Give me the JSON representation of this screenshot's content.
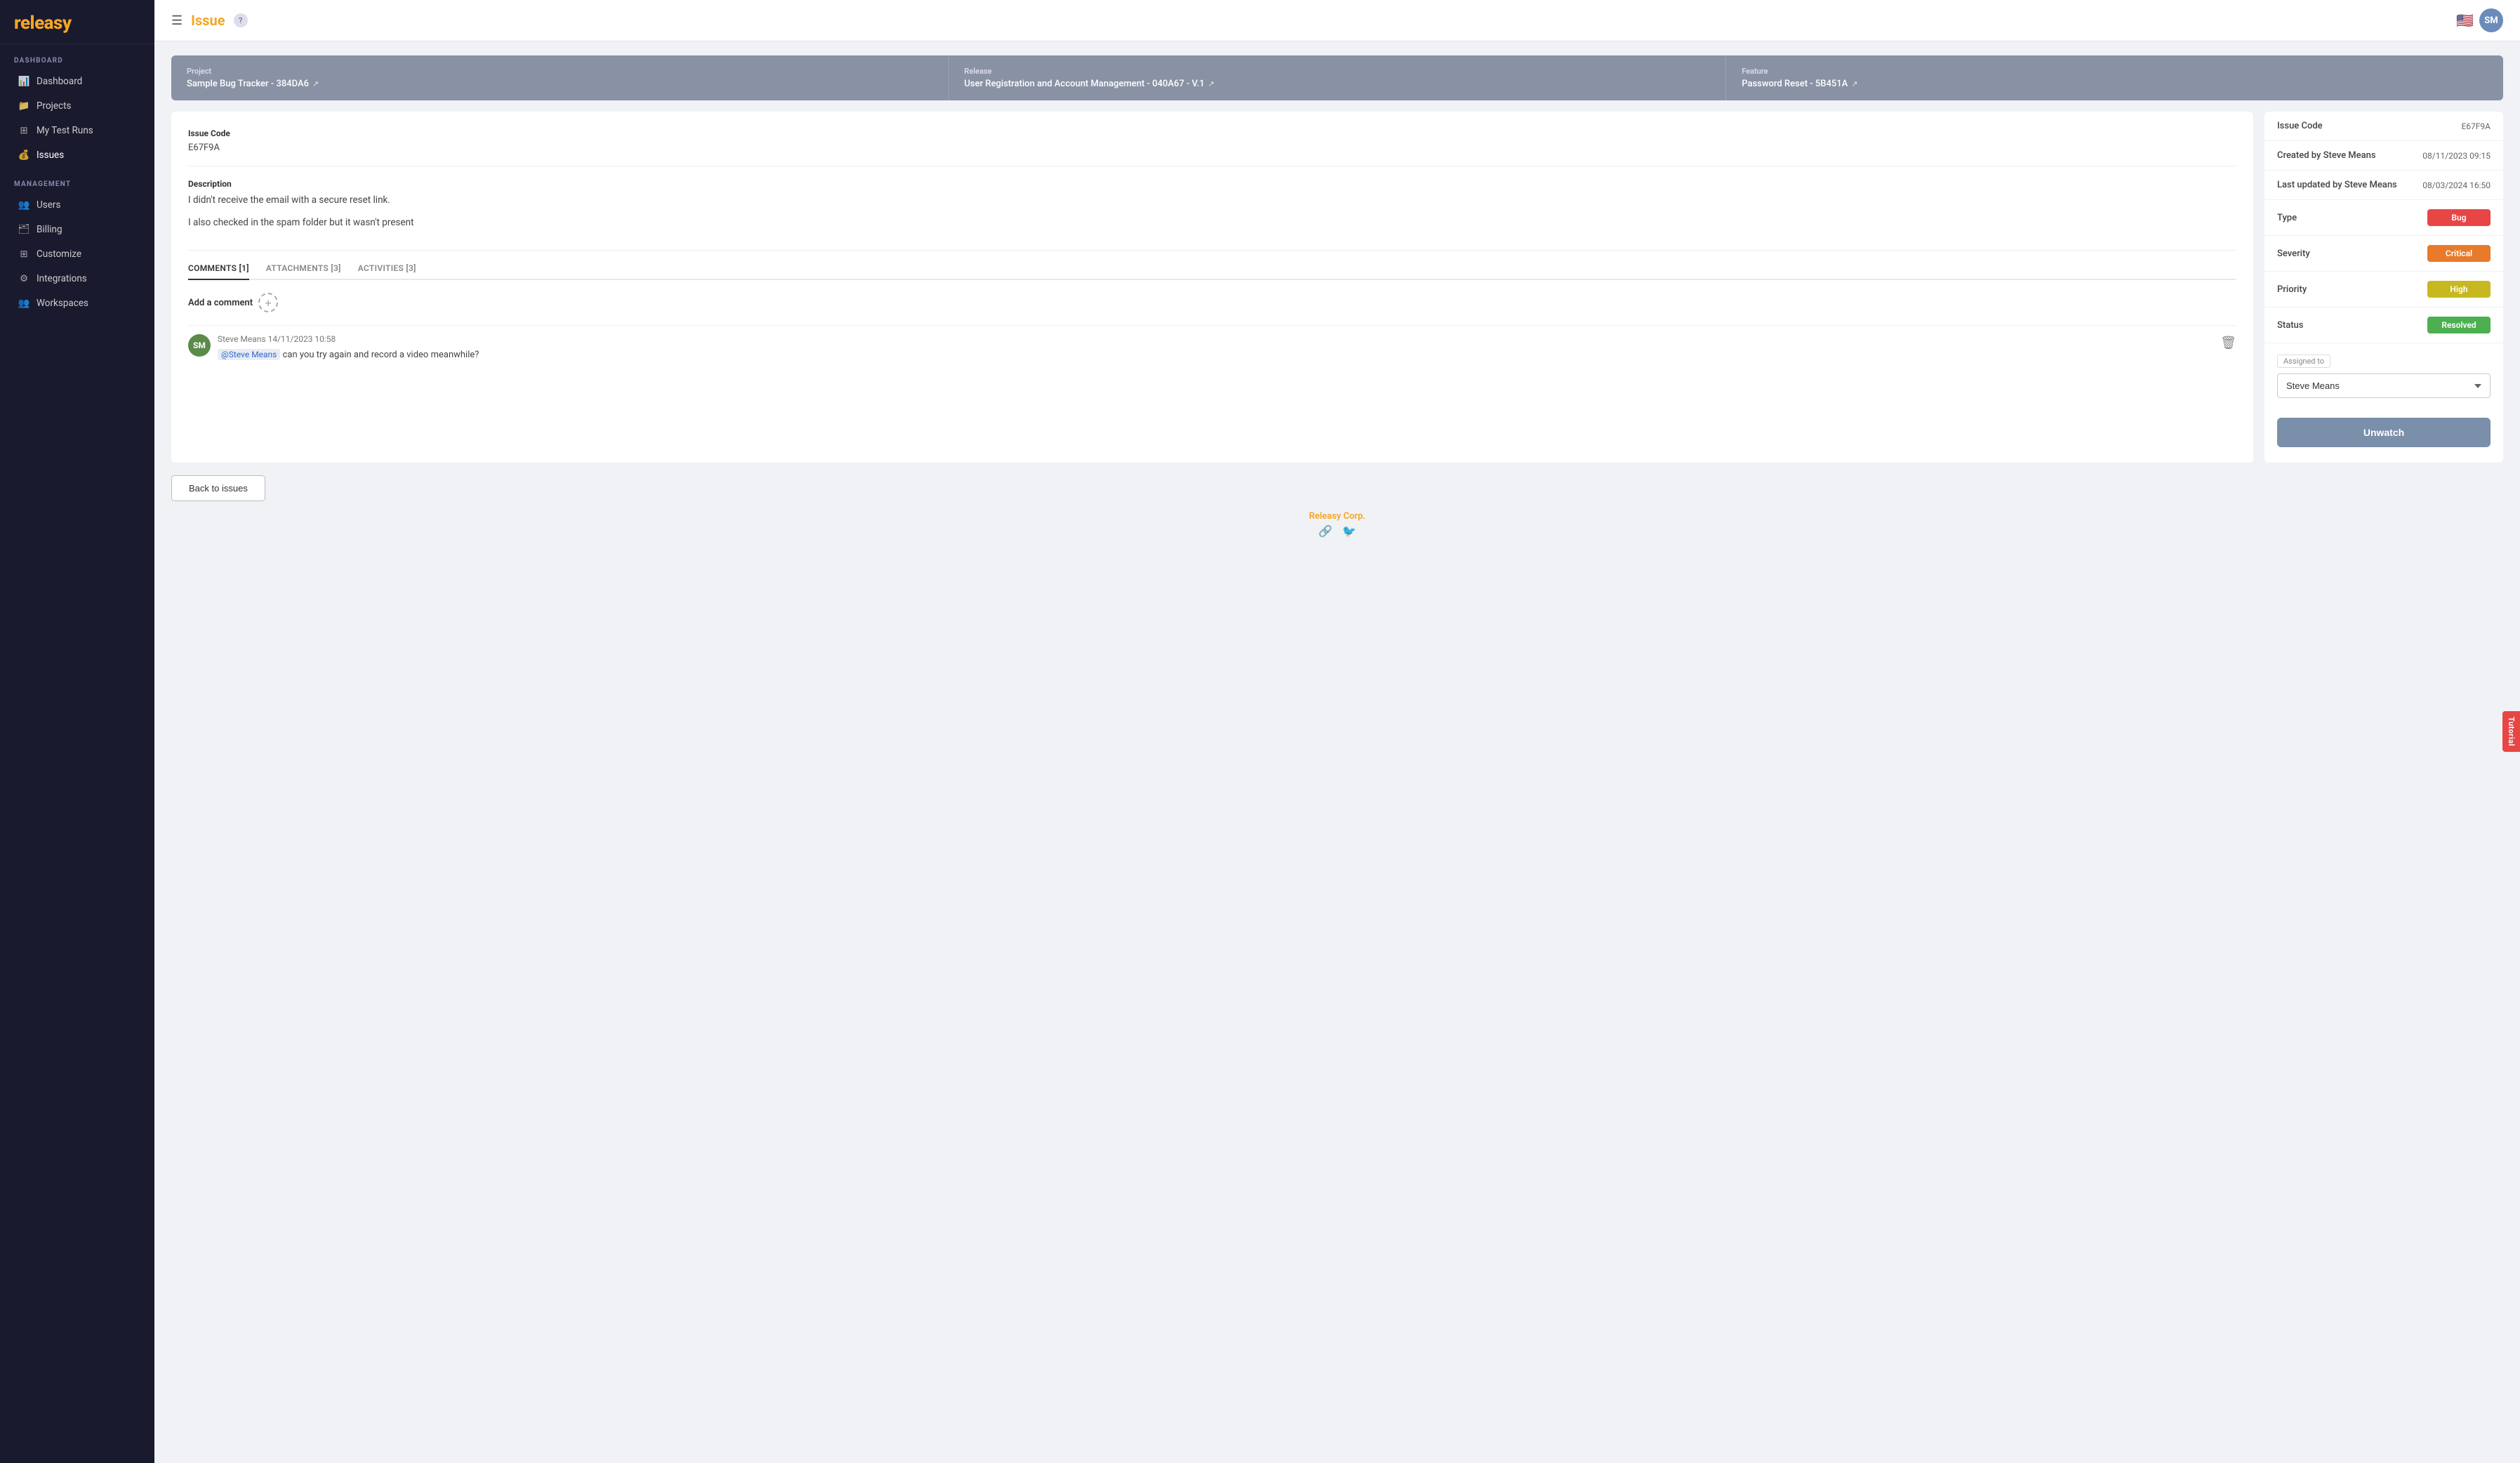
{
  "app": {
    "logo": "releasy",
    "title": "Issue",
    "help_icon": "?",
    "avatar_initials": "SM",
    "flag": "🇺🇸"
  },
  "sidebar": {
    "sections": [
      {
        "label": "DASHBOARD",
        "items": [
          {
            "id": "dashboard",
            "label": "Dashboard",
            "icon": "📊"
          },
          {
            "id": "projects",
            "label": "Projects",
            "icon": "📁"
          },
          {
            "id": "my-test-runs",
            "label": "My Test Runs",
            "icon": "⊞"
          },
          {
            "id": "issues",
            "label": "Issues",
            "icon": "💰"
          }
        ]
      },
      {
        "label": "MANAGEMENT",
        "items": [
          {
            "id": "users",
            "label": "Users",
            "icon": "👥"
          },
          {
            "id": "billing",
            "label": "Billing",
            "icon": "🗂"
          },
          {
            "id": "customize",
            "label": "Customize",
            "icon": "⊞"
          },
          {
            "id": "integrations",
            "label": "Integrations",
            "icon": "⚙"
          },
          {
            "id": "workspaces",
            "label": "Workspaces",
            "icon": "👥"
          }
        ]
      }
    ]
  },
  "info_bar": {
    "project_label": "Project",
    "project_value": "Sample Bug Tracker - 384DA6",
    "release_label": "Release",
    "release_value": "User Registration and Account Management - 040A67 - V.1",
    "feature_label": "Feature",
    "feature_value": "Password Reset - 5B451A"
  },
  "issue": {
    "code_label": "Issue Code",
    "code_value": "E67F9A",
    "description_label": "Description",
    "description_lines": [
      "I didn't receive the email with a secure reset link.",
      "I also checked in the spam folder but it wasn't present"
    ]
  },
  "tabs": [
    {
      "id": "comments",
      "label": "COMMENTS [1]",
      "active": true
    },
    {
      "id": "attachments",
      "label": "ATTACHMENTS [3]",
      "active": false
    },
    {
      "id": "activities",
      "label": "ACTIVITIES [3]",
      "active": false
    }
  ],
  "comments": {
    "add_label": "Add a comment",
    "add_icon": "+",
    "items": [
      {
        "id": "comment-1",
        "avatar_initials": "SM",
        "author": "Steve Means",
        "date": "14/11/2023 10:58",
        "mention": "@Steve Means",
        "text": " can you try again and record a video meanwhile?"
      }
    ]
  },
  "detail_panel": {
    "rows": [
      {
        "label": "Issue Code",
        "value": "E67F9A",
        "type": "text"
      },
      {
        "label": "Created by Steve Means",
        "value": "08/11/2023 09:15",
        "type": "text"
      },
      {
        "label": "Last updated by Steve Means",
        "value": "08/03/2024 16:50",
        "type": "text"
      },
      {
        "label": "Type",
        "value": "Bug",
        "type": "badge",
        "badge_class": "badge-bug"
      },
      {
        "label": "Severity",
        "value": "Critical",
        "type": "badge",
        "badge_class": "badge-critical"
      },
      {
        "label": "Priority",
        "value": "High",
        "type": "badge",
        "badge_class": "badge-high"
      },
      {
        "label": "Status",
        "value": "Resolved",
        "type": "badge",
        "badge_class": "badge-resolved"
      }
    ],
    "assigned_label": "Assigned to",
    "assigned_value": "Steve Means",
    "unwatch_label": "Unwatch"
  },
  "back_button": "Back to issues",
  "footer": {
    "company": "Releasy Corp.",
    "link_icon": "🔗",
    "twitter_icon": "🐦"
  },
  "tutorial_tab": "Tutorial"
}
